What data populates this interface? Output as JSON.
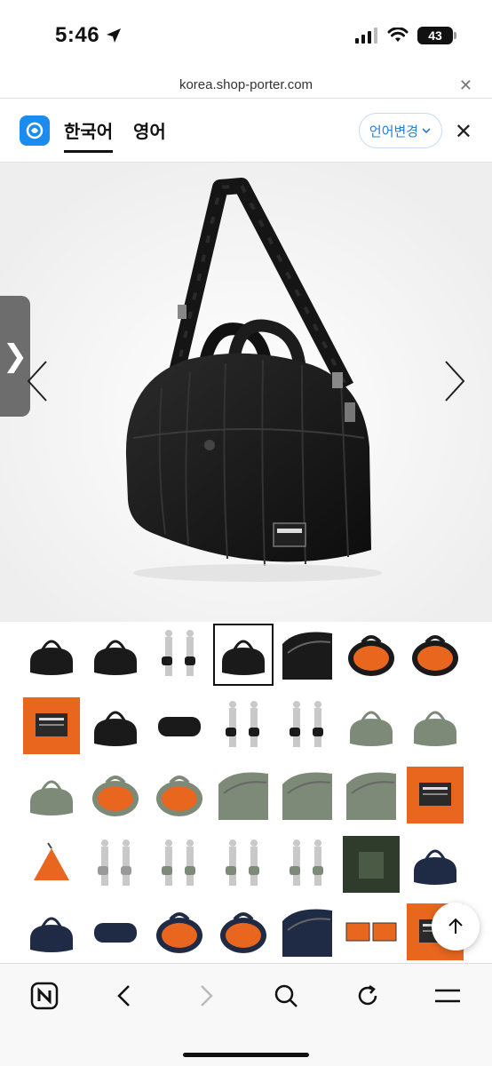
{
  "status": {
    "time": "5:46",
    "battery": "43"
  },
  "browser": {
    "url": "korea.shop-porter.com"
  },
  "translate": {
    "tabs": [
      {
        "label": "한국어",
        "active": true
      },
      {
        "label": "영어",
        "active": false
      }
    ],
    "change_label": "언어변경"
  },
  "colors": {
    "accent": "#1a8cf0",
    "orange": "#e8661e",
    "olive": "#7d8a78",
    "navy": "#1f2a44",
    "black": "#1a1a1a"
  },
  "gallery": {
    "rows": [
      [
        "black-bag",
        "black-bag",
        "model-black",
        "black-bag-selected",
        "black-detail",
        "black-open",
        "black-open"
      ],
      [
        "orange-card",
        "black-bag",
        "black-pouch",
        "model-black",
        "model-black",
        "olive-bag",
        "olive-bag"
      ],
      [
        "olive-bag",
        "olive-open",
        "olive-open",
        "olive-detail",
        "olive-detail",
        "olive-detail",
        "orange-card"
      ],
      [
        "orange-drawstring",
        "model-gray",
        "model-olive",
        "model-olive",
        "model-olive",
        "olive-card",
        "navy-bag"
      ],
      [
        "navy-bag",
        "navy-pouch",
        "navy-open",
        "navy-open",
        "navy-detail",
        "orange-wallet",
        "orange-card"
      ]
    ]
  },
  "nav": {
    "icons": [
      "naver-home-icon",
      "back-icon",
      "forward-icon",
      "search-icon",
      "refresh-icon",
      "menu-icon"
    ]
  }
}
